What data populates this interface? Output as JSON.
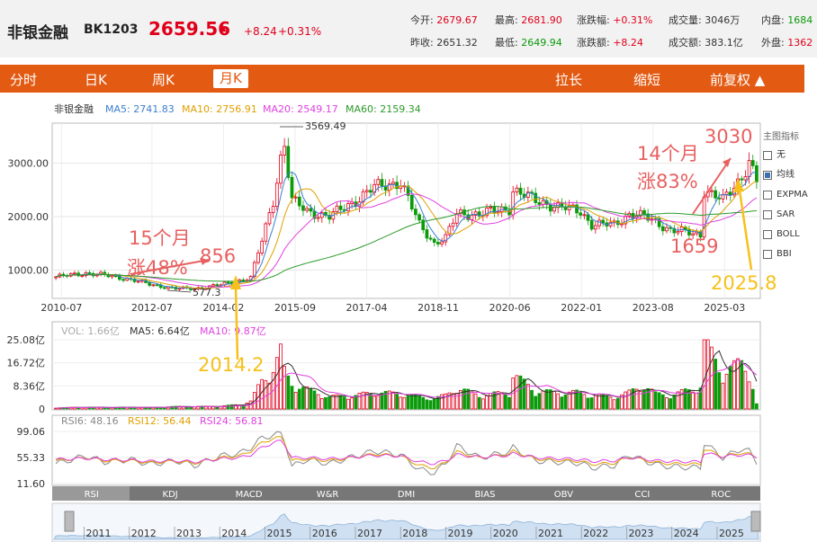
{
  "header": {
    "name": "非银金融",
    "code": "BK1203",
    "price": "2659.56",
    "change": "+8.24",
    "change_pct": "+0.31%",
    "quote_cells": [
      {
        "label": "今开:",
        "value": "2679.67",
        "tone": "r"
      },
      {
        "label": "最高:",
        "value": "2681.90",
        "tone": "r"
      },
      {
        "label": "涨跌幅:",
        "value": "+0.31%",
        "tone": "r"
      },
      {
        "label": "成交量:",
        "value": "3046万",
        "tone": "v"
      },
      {
        "label": "内盘:",
        "value": "1684",
        "tone": "g"
      },
      {
        "label": "昨收:",
        "value": "2651.32",
        "tone": "v"
      },
      {
        "label": "最低:",
        "value": "2649.94",
        "tone": "g"
      },
      {
        "label": "涨跌额:",
        "value": "+8.24",
        "tone": "r"
      },
      {
        "label": "成交额:",
        "value": "383.1亿",
        "tone": "v"
      },
      {
        "label": "外盘:",
        "value": "1362",
        "tone": "r"
      }
    ]
  },
  "tabs": {
    "fenshi": "分时",
    "day": "日K",
    "week": "周K",
    "month": "月K",
    "stretch": "拉长",
    "shrink": "缩短",
    "fuquan": "前复权 ▲"
  },
  "main_legend": {
    "name": "非银金融",
    "ma5": "MA5: 2741.83",
    "ma10": "MA10: 2756.91",
    "ma20": "MA20: 2549.17",
    "ma60": "MA60: 2159.34"
  },
  "indicator_panel": {
    "title": "主图指标",
    "items": [
      {
        "label": "无",
        "checked": false
      },
      {
        "label": "均线",
        "checked": true
      },
      {
        "label": "EXPMA",
        "checked": false
      },
      {
        "label": "SAR",
        "checked": false
      },
      {
        "label": "BOLL",
        "checked": false
      },
      {
        "label": "BBI",
        "checked": false
      }
    ]
  },
  "vol_legend": {
    "vol": "VOL: 1.66亿",
    "ma5": "MA5: 6.64亿",
    "ma10": "MA10: 9.87亿"
  },
  "rsi_legend": {
    "rsi6": "RSI6: 48.16",
    "rsi12": "RSI12: 56.44",
    "rsi24": "RSI24: 56.81"
  },
  "indicator_tabs": [
    "RSI",
    "KDJ",
    "MACD",
    "W&R",
    "DMI",
    "BIAS",
    "OBV",
    "CCI",
    "ROC"
  ],
  "annotations": {
    "a1": "15个月",
    "a2": "涨48%",
    "a3": "856",
    "a4": "2014.2",
    "a5": "14个月",
    "a6": "涨83%",
    "a7": "3030",
    "a8": "1659",
    "a9": "2025.8",
    "low_label": "577.3",
    "high_label": "3569.49"
  },
  "colors": {
    "up": "#e0001b",
    "down": "#0a9a0a",
    "accent": "#e35a12",
    "ma5": "#3a7fd0",
    "ma10": "#e0a000",
    "ma20": "#e040e0",
    "ma60": "#2a9a2a",
    "annotation_red": "#e86060",
    "annotation_yellow": "#f6c11b"
  },
  "chart_data": {
    "type": "candlestick",
    "title": "非银金融 BK1203 月K",
    "y_ticks": [
      "3000.00",
      "2000.00",
      "1000.00"
    ],
    "ylim": [
      500,
      3700
    ],
    "x_ticks": [
      "2010-07",
      "2012-07",
      "2014-02",
      "2015-09",
      "2017-04",
      "2018-11",
      "2020-06",
      "2022-01",
      "2023-08",
      "2025-03"
    ],
    "x_range": [
      "2010-05",
      "2025-12"
    ],
    "key_points": [
      {
        "date": "2013-06",
        "value": 577.3,
        "label": "low"
      },
      {
        "date": "2015-06",
        "value": 3569.49,
        "label": "high"
      }
    ],
    "ma_values": {
      "MA5": 2741.83,
      "MA10": 2756.91,
      "MA20": 2549.17,
      "MA60": 2159.34
    },
    "trend": [
      [
        "2010-05",
        870
      ],
      [
        "2011-01",
        940
      ],
      [
        "2011-06",
        900
      ],
      [
        "2012-01",
        820
      ],
      [
        "2012-06",
        730
      ],
      [
        "2013-01",
        650
      ],
      [
        "2013-06",
        650
      ],
      [
        "2014-01",
        720
      ],
      [
        "2014-06",
        800
      ],
      [
        "2014-09",
        860
      ],
      [
        "2014-12",
        1550
      ],
      [
        "2015-03",
        2300
      ],
      [
        "2015-05",
        3100
      ],
      [
        "2015-06",
        3350
      ],
      [
        "2015-08",
        2300
      ],
      [
        "2015-12",
        2100
      ],
      [
        "2016-06",
        2000
      ],
      [
        "2017-01",
        2300
      ],
      [
        "2017-06",
        2550
      ],
      [
        "2018-01",
        2650
      ],
      [
        "2018-06",
        1850
      ],
      [
        "2018-10",
        1500
      ],
      [
        "2019-01",
        1600
      ],
      [
        "2019-04",
        2050
      ],
      [
        "2019-10",
        2050
      ],
      [
        "2020-06",
        2150
      ],
      [
        "2020-07",
        2500
      ],
      [
        "2021-01",
        2300
      ],
      [
        "2021-06",
        2200
      ],
      [
        "2022-01",
        2100
      ],
      [
        "2022-04",
        1850
      ],
      [
        "2022-10",
        1850
      ],
      [
        "2023-02",
        2050
      ],
      [
        "2023-06",
        2000
      ],
      [
        "2023-09",
        1900
      ],
      [
        "2024-01",
        1750
      ],
      [
        "2024-09",
        1659
      ],
      [
        "2024-10",
        2500
      ],
      [
        "2025-03",
        2300
      ],
      [
        "2025-08",
        2750
      ],
      [
        "2025-10",
        3030
      ],
      [
        "2025-12",
        2659
      ]
    ],
    "volume_ticks": [
      "25.08亿",
      "16.72亿",
      "8.36亿",
      "0"
    ],
    "volume_max": 25.08,
    "volume_bars": [
      [
        "2010-05",
        0.4
      ],
      [
        "2011-01",
        0.6
      ],
      [
        "2011-06",
        0.5
      ],
      [
        "2012-01",
        0.6
      ],
      [
        "2012-06",
        0.5
      ],
      [
        "2013-01",
        0.8
      ],
      [
        "2013-06",
        0.8
      ],
      [
        "2014-01",
        0.9
      ],
      [
        "2014-06",
        1.5
      ],
      [
        "2014-09",
        2.5
      ],
      [
        "2014-12",
        9.5
      ],
      [
        "2015-03",
        13.5
      ],
      [
        "2015-05",
        19.0
      ],
      [
        "2015-06",
        12.5
      ],
      [
        "2015-08",
        8.5
      ],
      [
        "2015-12",
        6.5
      ],
      [
        "2016-06",
        4.0
      ],
      [
        "2017-01",
        4.5
      ],
      [
        "2017-06",
        5.5
      ],
      [
        "2018-01",
        5.0
      ],
      [
        "2018-06",
        4.0
      ],
      [
        "2018-10",
        3.5
      ],
      [
        "2019-01",
        4.5
      ],
      [
        "2019-04",
        7.0
      ],
      [
        "2019-10",
        4.5
      ],
      [
        "2020-06",
        5.5
      ],
      [
        "2020-07",
        11.5
      ],
      [
        "2021-01",
        6.0
      ],
      [
        "2021-06",
        5.5
      ],
      [
        "2022-01",
        5.5
      ],
      [
        "2022-04",
        4.5
      ],
      [
        "2022-10",
        4.0
      ],
      [
        "2023-02",
        5.5
      ],
      [
        "2023-06",
        8.0
      ],
      [
        "2023-09",
        5.0
      ],
      [
        "2024-01",
        4.5
      ],
      [
        "2024-09",
        7.5
      ],
      [
        "2024-10",
        22.5
      ],
      [
        "2025-03",
        12.0
      ],
      [
        "2025-08",
        15.5
      ],
      [
        "2025-10",
        13.0
      ],
      [
        "2025-12",
        1.66
      ]
    ],
    "rsi_ticks": [
      "99.06",
      "55.33",
      "11.60"
    ],
    "rsi_range": [
      11.6,
      99.06
    ],
    "rsi6": [
      [
        "2010-05",
        45
      ],
      [
        "2011-01",
        58
      ],
      [
        "2011-06",
        48
      ],
      [
        "2012-01",
        52
      ],
      [
        "2012-06",
        44
      ],
      [
        "2013-01",
        50
      ],
      [
        "2013-06",
        42
      ],
      [
        "2014-01",
        58
      ],
      [
        "2014-06",
        62
      ],
      [
        "2014-09",
        72
      ],
      [
        "2014-12",
        88
      ],
      [
        "2015-03",
        93
      ],
      [
        "2015-05",
        95
      ],
      [
        "2015-06",
        85
      ],
      [
        "2015-08",
        40
      ],
      [
        "2015-12",
        52
      ],
      [
        "2016-06",
        45
      ],
      [
        "2017-01",
        58
      ],
      [
        "2017-06",
        66
      ],
      [
        "2018-01",
        60
      ],
      [
        "2018-06",
        35
      ],
      [
        "2018-10",
        30
      ],
      [
        "2019-01",
        45
      ],
      [
        "2019-04",
        75
      ],
      [
        "2019-10",
        55
      ],
      [
        "2020-06",
        65
      ],
      [
        "2020-07",
        72
      ],
      [
        "2021-01",
        50
      ],
      [
        "2021-06",
        48
      ],
      [
        "2022-01",
        46
      ],
      [
        "2022-04",
        38
      ],
      [
        "2022-10",
        42
      ],
      [
        "2023-02",
        60
      ],
      [
        "2023-06",
        50
      ],
      [
        "2023-09",
        44
      ],
      [
        "2024-01",
        40
      ],
      [
        "2024-09",
        38
      ],
      [
        "2024-10",
        80
      ],
      [
        "2025-03",
        55
      ],
      [
        "2025-08",
        70
      ],
      [
        "2025-10",
        66
      ],
      [
        "2025-12",
        48.16
      ]
    ],
    "rsi12": [
      [
        "2010-05",
        50
      ],
      [
        "2011-01",
        55
      ],
      [
        "2011-06",
        50
      ],
      [
        "2012-01",
        50
      ],
      [
        "2012-06",
        47
      ],
      [
        "2013-01",
        49
      ],
      [
        "2013-06",
        46
      ],
      [
        "2014-01",
        55
      ],
      [
        "2014-06",
        58
      ],
      [
        "2014-09",
        66
      ],
      [
        "2014-12",
        80
      ],
      [
        "2015-03",
        87
      ],
      [
        "2015-05",
        89
      ],
      [
        "2015-06",
        82
      ],
      [
        "2015-08",
        50
      ],
      [
        "2015-12",
        53
      ],
      [
        "2016-06",
        50
      ],
      [
        "2017-01",
        56
      ],
      [
        "2017-06",
        61
      ],
      [
        "2018-01",
        58
      ],
      [
        "2018-06",
        42
      ],
      [
        "2018-10",
        38
      ],
      [
        "2019-01",
        47
      ],
      [
        "2019-04",
        65
      ],
      [
        "2019-10",
        55
      ],
      [
        "2020-06",
        61
      ],
      [
        "2020-07",
        66
      ],
      [
        "2021-01",
        53
      ],
      [
        "2021-06",
        51
      ],
      [
        "2022-01",
        49
      ],
      [
        "2022-04",
        44
      ],
      [
        "2022-10",
        46
      ],
      [
        "2023-02",
        56
      ],
      [
        "2023-06",
        51
      ],
      [
        "2023-09",
        47
      ],
      [
        "2024-01",
        45
      ],
      [
        "2024-09",
        44
      ],
      [
        "2024-10",
        70
      ],
      [
        "2025-03",
        57
      ],
      [
        "2025-08",
        63
      ],
      [
        "2025-10",
        61
      ],
      [
        "2025-12",
        56.44
      ]
    ],
    "rsi24": [
      [
        "2010-05",
        52
      ],
      [
        "2011-01",
        54
      ],
      [
        "2011-06",
        52
      ],
      [
        "2012-01",
        51
      ],
      [
        "2012-06",
        49
      ],
      [
        "2013-01",
        50
      ],
      [
        "2013-06",
        48
      ],
      [
        "2014-01",
        53
      ],
      [
        "2014-06",
        55
      ],
      [
        "2014-09",
        60
      ],
      [
        "2014-12",
        72
      ],
      [
        "2015-03",
        80
      ],
      [
        "2015-05",
        83
      ],
      [
        "2015-06",
        78
      ],
      [
        "2015-08",
        55
      ],
      [
        "2015-12",
        55
      ],
      [
        "2016-06",
        53
      ],
      [
        "2017-01",
        56
      ],
      [
        "2017-06",
        59
      ],
      [
        "2018-01",
        58
      ],
      [
        "2018-06",
        48
      ],
      [
        "2018-10",
        45
      ],
      [
        "2019-01",
        50
      ],
      [
        "2019-04",
        60
      ],
      [
        "2019-10",
        56
      ],
      [
        "2020-06",
        59
      ],
      [
        "2020-07",
        62
      ],
      [
        "2021-01",
        55
      ],
      [
        "2021-06",
        54
      ],
      [
        "2022-01",
        52
      ],
      [
        "2022-04",
        49
      ],
      [
        "2022-10",
        50
      ],
      [
        "2023-02",
        55
      ],
      [
        "2023-06",
        53
      ],
      [
        "2023-09",
        50
      ],
      [
        "2024-01",
        49
      ],
      [
        "2024-09",
        48
      ],
      [
        "2024-10",
        63
      ],
      [
        "2025-03",
        57
      ],
      [
        "2025-08",
        60
      ],
      [
        "2025-10",
        59
      ],
      [
        "2025-12",
        56.81
      ]
    ],
    "nav_years": [
      "2011",
      "2012",
      "2013",
      "2014",
      "2015",
      "2016",
      "2017",
      "2018",
      "2019",
      "2020",
      "2021",
      "2022",
      "2023",
      "2024",
      "2025"
    ]
  }
}
